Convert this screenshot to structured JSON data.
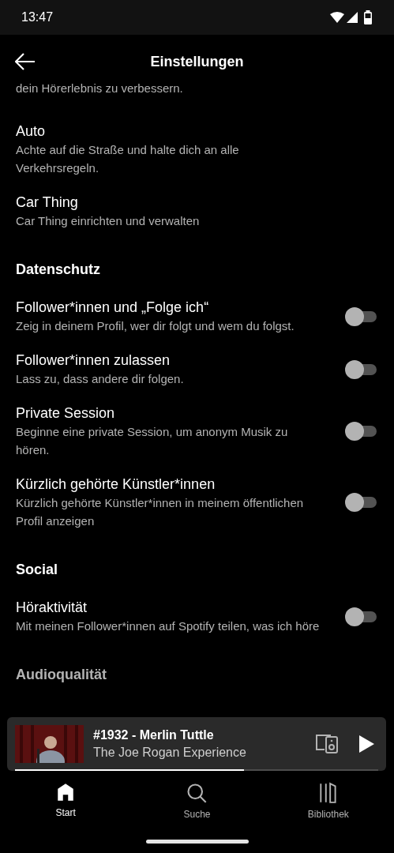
{
  "status_bar": {
    "time": "13:47"
  },
  "header": {
    "title": "Einstellungen"
  },
  "sections": [
    {
      "kind": "items",
      "items": [
        {
          "kind": "text",
          "subtitle": "dein Hörerlebnis zu verbessern."
        }
      ]
    },
    {
      "kind": "items",
      "items": [
        {
          "kind": "link",
          "title": "Auto",
          "subtitle": "Achte auf die Straße und halte dich an alle Verkehrsregeln."
        },
        {
          "kind": "link",
          "title": "Car Thing",
          "subtitle": "Car Thing einrichten und verwalten"
        }
      ]
    },
    {
      "kind": "section",
      "heading": "Datenschutz",
      "items": [
        {
          "kind": "toggle",
          "title": "Follower*innen und „Folge ich“",
          "subtitle": "Zeig in deinem Profil, wer dir folgt und wem du folgst.",
          "on": false
        },
        {
          "kind": "toggle",
          "title": "Follower*innen zulassen",
          "subtitle": "Lass zu, dass andere dir folgen.",
          "on": false
        },
        {
          "kind": "toggle",
          "title": "Private Session",
          "subtitle": "Beginne eine private Session, um anonym Musik zu hören.",
          "on": false
        },
        {
          "kind": "toggle",
          "title": "Kürzlich gehörte Künstler*innen",
          "subtitle": "Kürzlich gehörte Künstler*innen in meinem öffentlichen Profil anzeigen",
          "on": false
        }
      ]
    },
    {
      "kind": "section",
      "heading": "Social",
      "items": [
        {
          "kind": "toggle",
          "title": "Höraktivität",
          "subtitle": "Mit meinen Follower*innen auf Spotify teilen, was ich höre",
          "on": false
        }
      ]
    },
    {
      "kind": "section",
      "heading": "Audioqualität"
    }
  ],
  "now_playing": {
    "title": "#1932 - Merlin Tuttle",
    "subtitle": "The Joe Rogan Experience",
    "level": 0.63
  },
  "nav": [
    {
      "label": "Start",
      "selected": true
    },
    {
      "label": "Suche",
      "selected": false
    },
    {
      "label": "Bibliothek",
      "selected": false
    }
  ]
}
